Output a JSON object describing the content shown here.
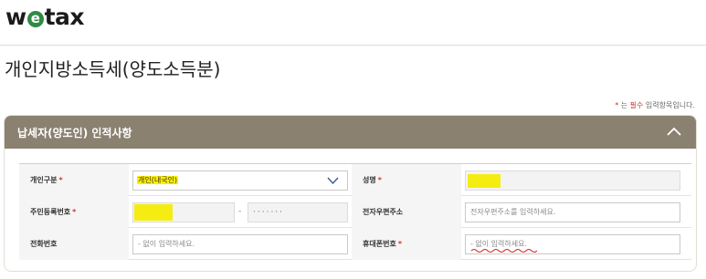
{
  "header": {
    "logo_pre": "w",
    "logo_mid": "e",
    "logo_post": "tax"
  },
  "page": {
    "title": "개인지방소득세(양도소득분)"
  },
  "required_note": {
    "star": "*",
    "pre": " 는 ",
    "em": "필수",
    "post": " 입력항목입니다."
  },
  "panel": {
    "title": "납세자(양도인) 인적사항",
    "collapse_icon": "chevron-up-icon"
  },
  "form": {
    "required_mark": "*",
    "taxpayer_type": {
      "label": "개인구분",
      "value": "개인(내국인)",
      "icon": "chevron-down-icon"
    },
    "name": {
      "label": "성명"
    },
    "resident_number": {
      "label": "주민등록번호",
      "separator": "-",
      "back_mask": "·······"
    },
    "email_zip": {
      "label": "전자우편주소",
      "placeholder": "전자우편주소를 입력하세요."
    },
    "phone": {
      "label": "전화번호",
      "placeholder": "- 없이 입력하세요."
    },
    "mobile": {
      "label": "휴대폰번호",
      "placeholder": "- 없이 입력하세요."
    }
  },
  "colors": {
    "panel_header": "#8b8171",
    "highlight": "#fff000",
    "required": "#d9322b",
    "logo_accent": "#2e8b45"
  }
}
